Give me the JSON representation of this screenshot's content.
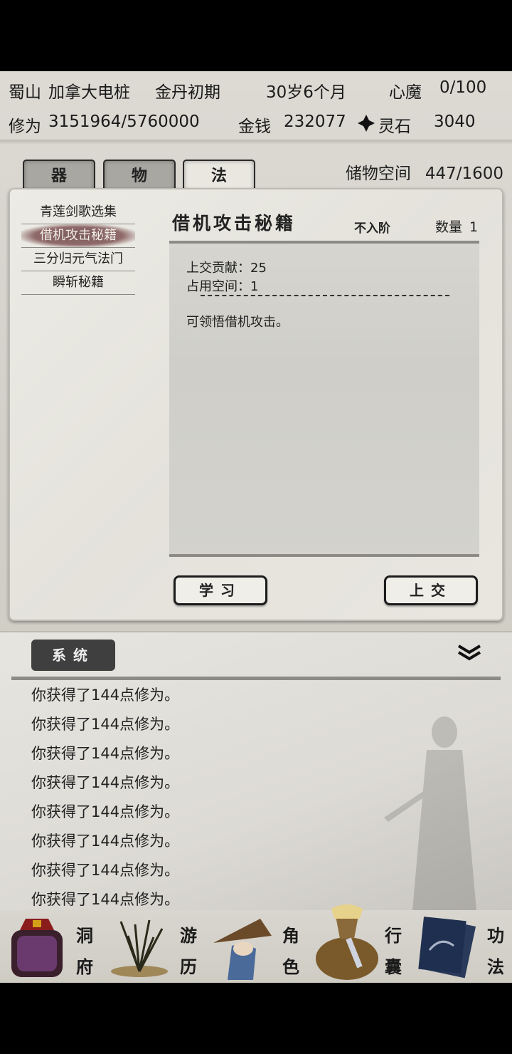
{
  "status": {
    "location": "蜀山",
    "name": "加拿大电桩",
    "realm": "金丹初期",
    "age": "30岁6个月",
    "demon_label": "心魔",
    "demon_value": "0/100",
    "cultivation_label": "修为",
    "cultivation_value": "3151964/5760000",
    "money_label": "金钱",
    "money_value": "232077",
    "lingshi_label": "灵石",
    "lingshi_value": "3040"
  },
  "tabs": [
    {
      "label": "器"
    },
    {
      "label": "物"
    },
    {
      "label": "法"
    }
  ],
  "storage": {
    "label": "储物空间",
    "value": "447/1600"
  },
  "book_list": [
    {
      "label": "青莲剑歌选集"
    },
    {
      "label": "借机攻击秘籍"
    },
    {
      "label": "三分归元气法门"
    },
    {
      "label": "瞬斩秘籍"
    }
  ],
  "detail": {
    "title": "借机攻击秘籍",
    "grade": "不入阶",
    "qty_label": "数量",
    "qty_value": "1",
    "contribution": "上交贡献：25",
    "space": "占用空间：1",
    "description": "可领悟借机攻击。",
    "learn_button": "学习",
    "submit_button": "上交"
  },
  "log": {
    "tab_label": "系统",
    "lines": [
      "你获得了144点修为。",
      "你获得了144点修为。",
      "你获得了144点修为。",
      "你获得了144点修为。",
      "你获得了144点修为。",
      "你获得了144点修为。",
      "你获得了144点修为。",
      "你获得了144点修为。"
    ]
  },
  "nav": [
    {
      "label": "洞府",
      "icon": "cave-icon"
    },
    {
      "label": "游历",
      "icon": "travel-icon"
    },
    {
      "label": "角色",
      "icon": "character-icon"
    },
    {
      "label": "行囊",
      "icon": "bag-icon"
    },
    {
      "label": "功法",
      "icon": "scripture-icon"
    }
  ],
  "colors": {
    "selected_item": "#7b5a5a",
    "panel": "#e8e6df",
    "log_tab": "#3f3f3f"
  }
}
